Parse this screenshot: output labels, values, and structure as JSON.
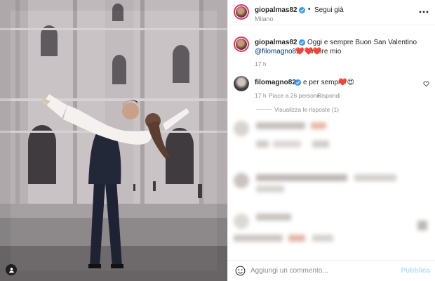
{
  "post": {
    "author": "giopalmas82",
    "follow_separator": "•",
    "follow_label": "Segui già",
    "location": "Milano",
    "photo_icon": "person-tag-icon"
  },
  "caption": {
    "author": "giopalmas82",
    "text": "Oggi e sempre Buon San Valentino Amore mio",
    "mention": "@filomagno82",
    "hearts": "❤️❤️❤️",
    "time": "17 h"
  },
  "comment": {
    "author": "filomagno82",
    "text": "e per sempre!",
    "emojis": "❤️😍",
    "time": "17 h",
    "likes": "Piace a 26 persone",
    "reply_label": "Rispondi",
    "view_replies": "Visualizza le risposte (1)"
  },
  "composer": {
    "placeholder": "Aggiungi un commento...",
    "publish_label": "Pubblica"
  },
  "colors": {
    "link": "#00376b",
    "verified": "#3897f0",
    "publish": "#b2dffc",
    "story_ring": "#e1306c"
  },
  "icons": [
    "verified-badge-icon",
    "more-options-icon",
    "heart-outline-icon",
    "emoji-icon",
    "person-tag-icon"
  ]
}
